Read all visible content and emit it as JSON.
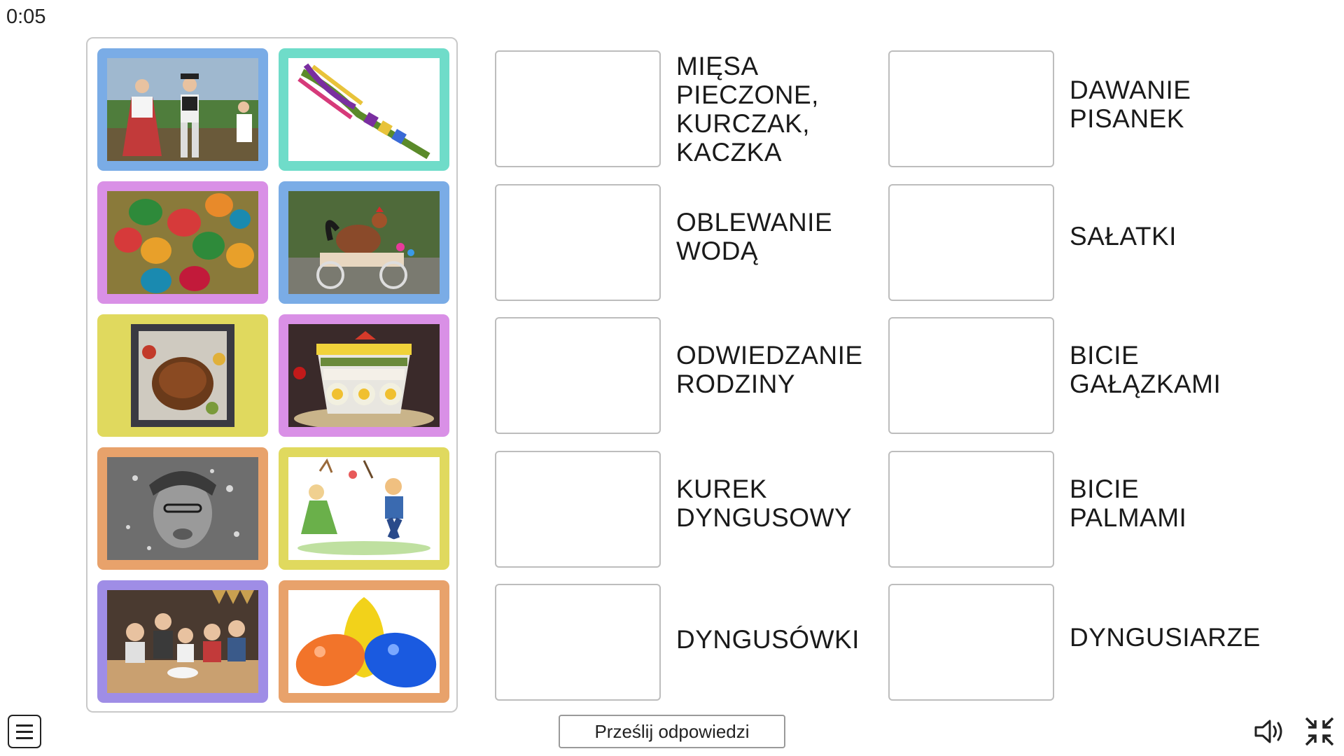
{
  "timer": "0:05",
  "cards": [
    {
      "name": "card-folk-musicians",
      "color": "#7aace6",
      "subject": "folk musicians"
    },
    {
      "name": "card-easter-palm",
      "color": "#6fdcc9",
      "subject": "easter palm"
    },
    {
      "name": "card-painted-eggs",
      "color": "#d990e6",
      "subject": "painted eggs"
    },
    {
      "name": "card-rooster-cart",
      "color": "#7aace6",
      "subject": "rooster cart"
    },
    {
      "name": "card-roast-chicken",
      "color": "#e0d95e",
      "subject": "roast chicken"
    },
    {
      "name": "card-layered-salad",
      "color": "#d990e6",
      "subject": "layered salad"
    },
    {
      "name": "card-water-splash",
      "color": "#e8a26b",
      "subject": "water splash"
    },
    {
      "name": "card-dyngus-cartoon",
      "color": "#e0d95e",
      "subject": "dyngus cartoon"
    },
    {
      "name": "card-family-dinner",
      "color": "#9f8de6",
      "subject": "family dinner"
    },
    {
      "name": "card-water-balloons",
      "color": "#e8a26b",
      "subject": "water balloons"
    }
  ],
  "targets": {
    "left": [
      {
        "label": "MIĘSA\nPIECZONE,\nKURCZAK,\nKACZKA"
      },
      {
        "label": "OBLEWANIE\nWODĄ"
      },
      {
        "label": "ODWIEDZANIE\nRODZINY"
      },
      {
        "label": "KUREK\nDYNGUSOWY"
      },
      {
        "label": "DYNGUSÓWKI"
      }
    ],
    "right": [
      {
        "label": "DAWANIE\nPISANEK"
      },
      {
        "label": "SAŁATKI"
      },
      {
        "label": "BICIE\nGAŁĄZKAMI"
      },
      {
        "label": "BICIE\nPALMAMI"
      },
      {
        "label": "DYNGUSIARZE"
      }
    ]
  },
  "buttons": {
    "submit": "Prześlij odpowiedzi",
    "menu_icon": "menu-icon",
    "sound_icon": "speaker-icon",
    "fullscreen_icon": "exit-fullscreen-icon"
  }
}
